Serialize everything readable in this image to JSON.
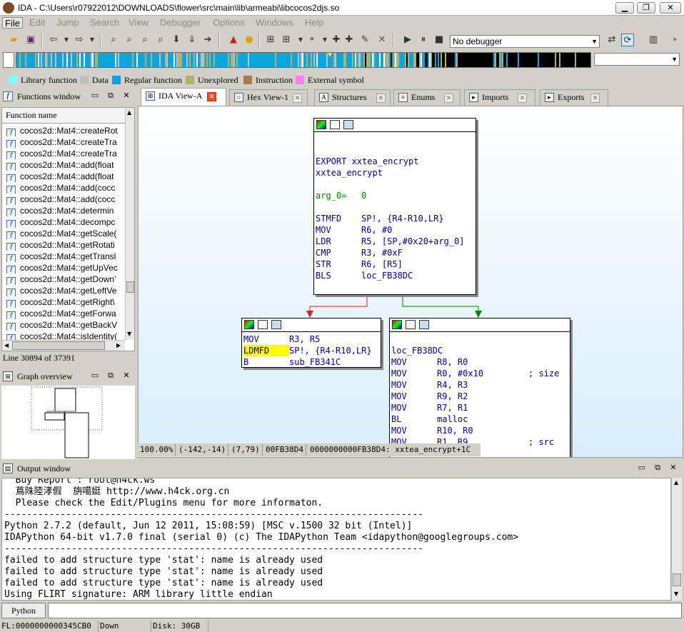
{
  "window": {
    "title": "IDA - C:\\Users\\r07922012\\DOWNLOADS\\flower\\src\\main\\lib\\armeabi\\libcocos2djs.so"
  },
  "menu": [
    "File",
    "Edit",
    "Jump",
    "Search",
    "View",
    "Debugger",
    "Options",
    "Windows",
    "Help"
  ],
  "toolbar": {
    "debugger_select": "No debugger",
    "second_select": ""
  },
  "legend": [
    {
      "label": "Library function",
      "color": "#80ffff"
    },
    {
      "label": "Data",
      "color": "#c0c0c0"
    },
    {
      "label": "Regular function",
      "color": "#00a0e8"
    },
    {
      "label": "Unexplored",
      "color": "#b0b070"
    },
    {
      "label": "Instruction",
      "color": "#b07850"
    },
    {
      "label": "External symbol",
      "color": "#ff80ff"
    }
  ],
  "functions_window": {
    "title": "Functions window",
    "column": "Function name",
    "rows": [
      "cocos2d::Mat4::createRot",
      "cocos2d::Mat4::createTra",
      "cocos2d::Mat4::createTra",
      "cocos2d::Mat4::add(float",
      "cocos2d::Mat4::add(float",
      "cocos2d::Mat4::add(cocc",
      "cocos2d::Mat4::add(cocc",
      "cocos2d::Mat4::determin",
      "cocos2d::Mat4::decompc",
      "cocos2d::Mat4::getScale(",
      "cocos2d::Mat4::getRotati",
      "cocos2d::Mat4::getTransl",
      "cocos2d::Mat4::getUpVec",
      "cocos2d::Mat4::getDown'",
      "cocos2d::Mat4::getLeftVe",
      "cocos2d::Mat4::getRight\\",
      "cocos2d::Mat4::getForwa",
      "cocos2d::Mat4::getBackV",
      "cocos2d::Mat4::isIdentity("
    ],
    "line_status": "Line 30894 of 37391"
  },
  "graph_overview": {
    "title": "Graph overview"
  },
  "tabs": [
    {
      "label": "IDA View-A",
      "active": true
    },
    {
      "label": "Hex View-1",
      "active": false
    },
    {
      "label": "Structures",
      "active": false
    },
    {
      "label": "Enums",
      "active": false
    },
    {
      "label": "Imports",
      "active": false
    },
    {
      "label": "Exports",
      "active": false
    }
  ],
  "graph": {
    "block1": [
      {
        "a": "EXPORT xxtea_encrypt",
        "b": ""
      },
      {
        "a": "xxtea_encrypt",
        "b": ""
      },
      {
        "a": "",
        "b": ""
      },
      {
        "a": "arg_0=",
        "b": "0"
      },
      {
        "a": "",
        "b": ""
      },
      {
        "a": "STMFD",
        "b": "SP!, {R4-R10,LR}"
      },
      {
        "a": "MOV",
        "b": "R6, #0"
      },
      {
        "a": "LDR",
        "b": "R5, [SP,#0x20+arg_0]"
      },
      {
        "a": "CMP",
        "b": "R3, #0xF"
      },
      {
        "a": "STR",
        "b": "R6, [R5]"
      },
      {
        "a": "BLS",
        "b": "loc_FB38DC"
      }
    ],
    "block2": [
      {
        "a": "MOV",
        "b": "R3, R5"
      },
      {
        "a": "LDMFD",
        "b": "SP!, {R4-R10,LR}"
      },
      {
        "a": "B",
        "b": "sub_FB341C"
      }
    ],
    "block3_label": "loc_FB38DC",
    "block3": [
      {
        "a": "MOV",
        "b": "R8, R0",
        "c": ""
      },
      {
        "a": "MOV",
        "b": "R0, #0x10",
        "c": "; size"
      },
      {
        "a": "MOV",
        "b": "R4, R3",
        "c": ""
      },
      {
        "a": "MOV",
        "b": "R9, R2",
        "c": ""
      },
      {
        "a": "MOV",
        "b": "R7, R1",
        "c": ""
      },
      {
        "a": "BL",
        "b": "malloc",
        "c": ""
      },
      {
        "a": "MOV",
        "b": "R10, R0",
        "c": ""
      },
      {
        "a": "MOV",
        "b": "R1, R9",
        "c": "; src"
      }
    ],
    "status": {
      "zoom": "100.00%",
      "coords": "(-142,-14)",
      "pos": "(7,79)",
      "addr": "00FB38D4",
      "location": "0000000000FB38D4: xxtea_encrypt+1C"
    }
  },
  "output_window": {
    "title": "Output window",
    "lines": [
      "  Buy Report : root@h4ck.ws",
      "  蔦陎陸涍假  旃噶娗 http://www.h4ck.org.cn",
      "  Please check the Edit/Plugins menu for more informaton.",
      "---------------------------------------------------------------------------",
      "Python 2.7.2 (default, Jun 12 2011, 15:08:59) [MSC v.1500 32 bit (Intel)]",
      "IDAPython 64-bit v1.7.0 final (serial 0) (c) The IDAPython Team <idapython@googlegroups.com>",
      "---------------------------------------------------------------------------",
      "failed to add structure type 'stat': name is already used",
      "failed to add structure type 'stat': name is already used",
      "failed to add structure type 'stat': name is already used",
      "Using FLIRT signature: ARM library little endian"
    ],
    "python_button": "Python"
  },
  "statusbar": {
    "fl": "FL:0000000000345CB0",
    "state": "Down",
    "disk": "Disk: 30GB"
  }
}
